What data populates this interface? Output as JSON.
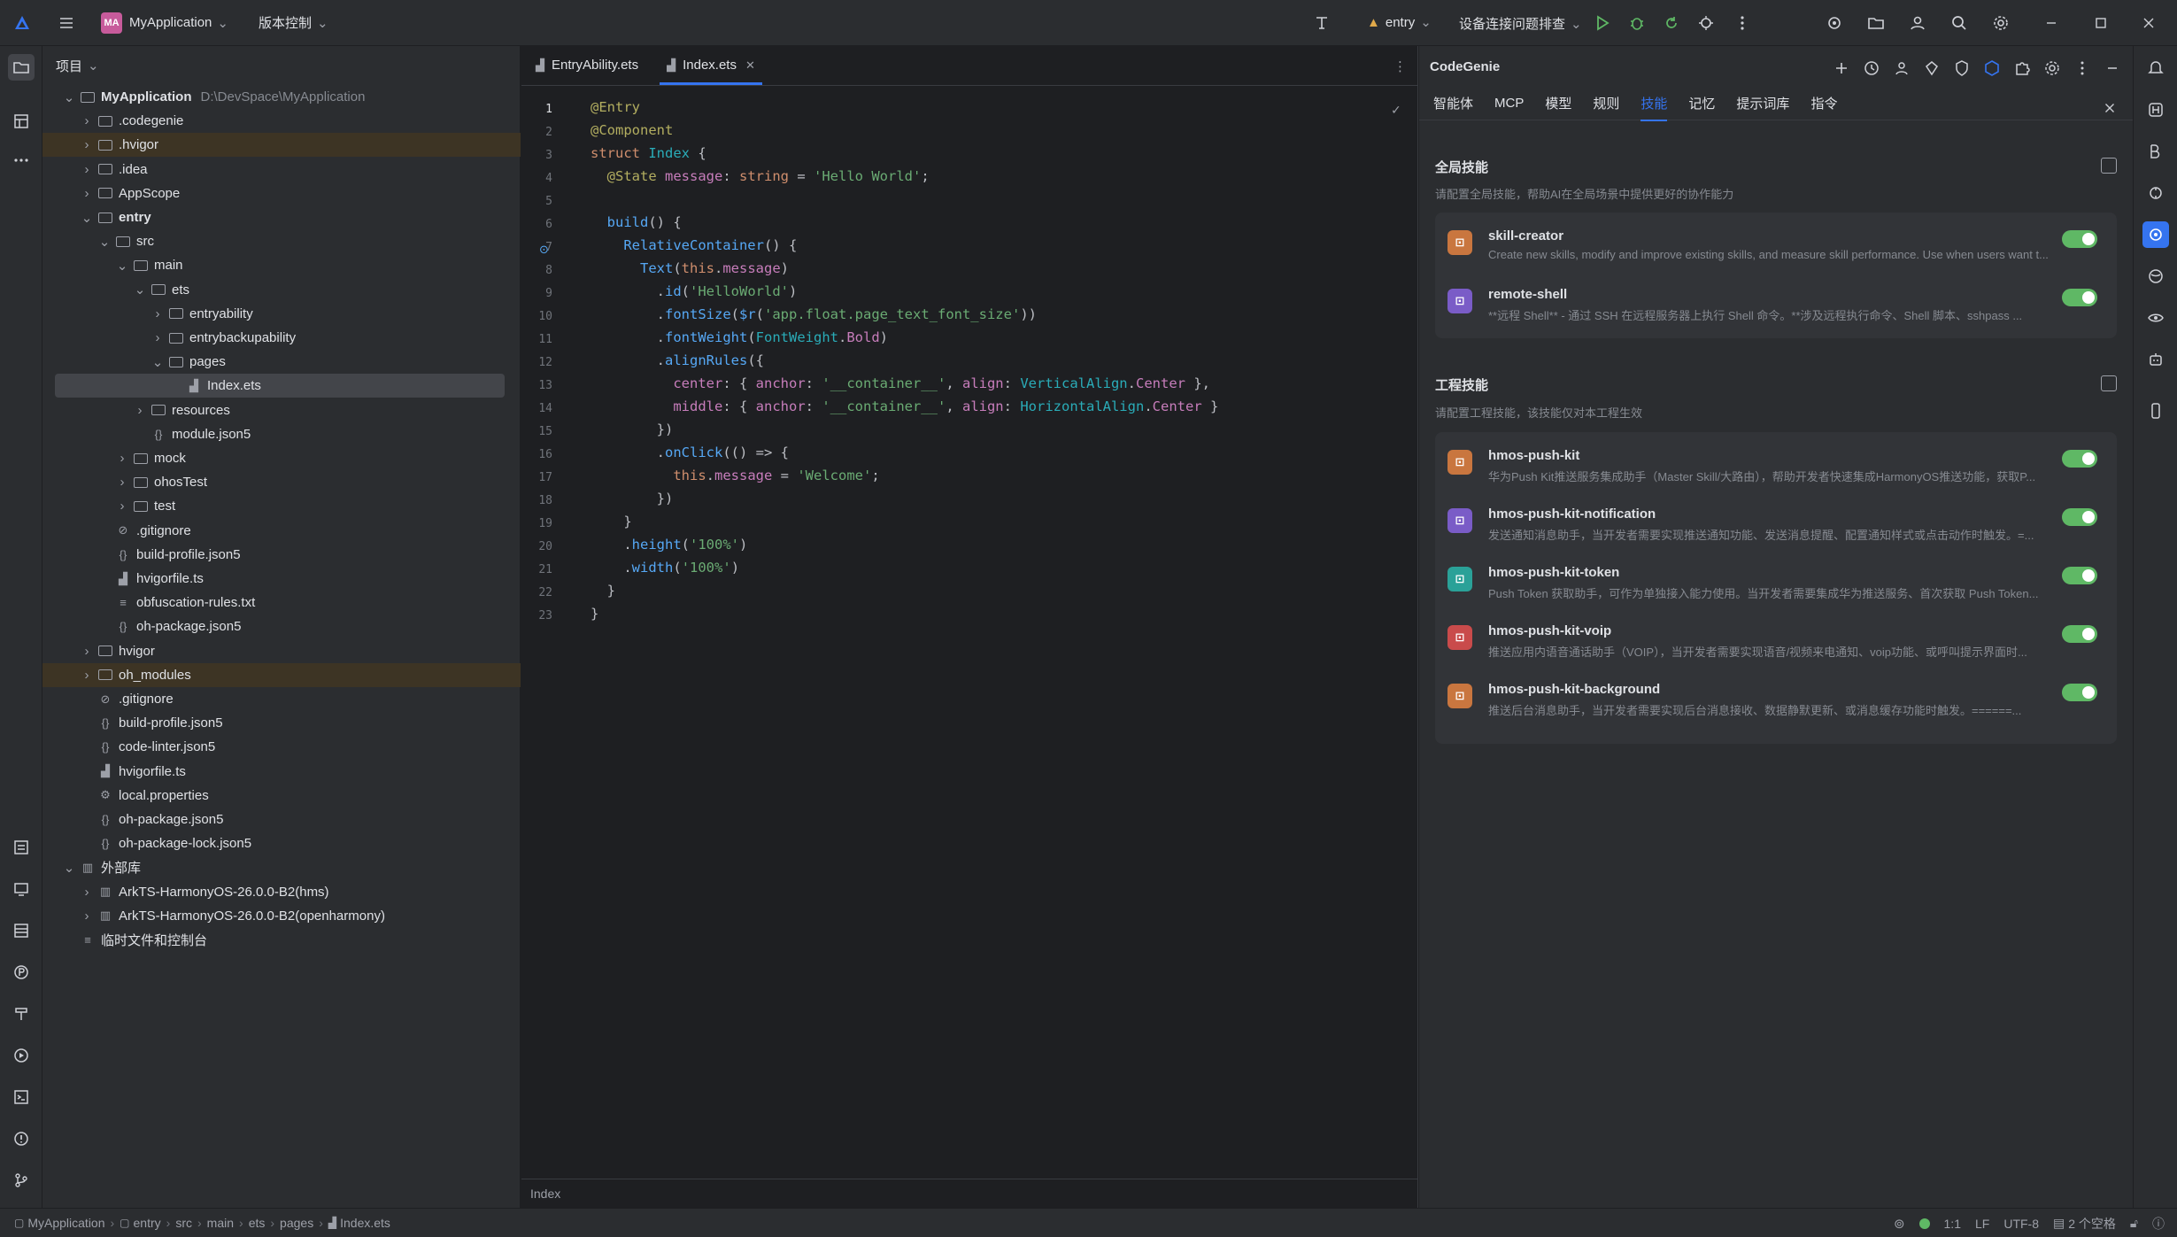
{
  "titlebar": {
    "project_badge": "MA",
    "project_name": "MyApplication",
    "vcs_label": "版本控制",
    "run_config": "entry",
    "device_label": "设备连接问题排查"
  },
  "project_panel": {
    "header": "项目",
    "root_name": "MyApplication",
    "root_path": "D:\\DevSpace\\MyApplication",
    "items": [
      ".codegenie",
      ".hvigor",
      ".idea",
      "AppScope",
      "entry",
      "src",
      "main",
      "ets",
      "entryability",
      "entrybackupability",
      "pages",
      "Index.ets",
      "resources",
      "module.json5",
      "mock",
      "ohosTest",
      "test",
      ".gitignore",
      "build-profile.json5",
      "hvigorfile.ts",
      "obfuscation-rules.txt",
      "oh-package.json5",
      "hvigor",
      "oh_modules",
      ".gitignore",
      "build-profile.json5",
      "code-linter.json5",
      "hvigorfile.ts",
      "local.properties",
      "oh-package.json5",
      "oh-package-lock.json5",
      "外部库",
      "ArkTS-HarmonyOS-26.0.0-B2(hms)",
      "ArkTS-HarmonyOS-26.0.0-B2(openharmony)",
      "临时文件和控制台"
    ]
  },
  "editor": {
    "tabs": [
      "EntryAbility.ets",
      "Index.ets"
    ],
    "footer": "Index",
    "line_numbers": [
      "1",
      "2",
      "3",
      "4",
      "5",
      "6",
      "7",
      "8",
      "9",
      "10",
      "11",
      "12",
      "13",
      "14",
      "15",
      "16",
      "17",
      "18",
      "19",
      "20",
      "21",
      "22",
      "23"
    ]
  },
  "codegenie": {
    "title": "CodeGenie",
    "tabs": [
      "智能体",
      "MCP",
      "模型",
      "规则",
      "技能",
      "记忆",
      "提示词库",
      "指令"
    ],
    "global_title": "全局技能",
    "global_sub": "请配置全局技能，帮助AI在全局场景中提供更好的协作能力",
    "project_title": "工程技能",
    "project_sub": "请配置工程技能，该技能仅对本工程生效",
    "global_skills": [
      {
        "name": "skill-creator",
        "desc": "Create new skills, modify and improve existing skills, and measure skill performance. Use when users want t..."
      },
      {
        "name": "remote-shell",
        "desc": "**远程 Shell** - 通过 SSH 在远程服务器上执行 Shell 命令。**涉及远程执行命令、Shell 脚本、sshpass ..."
      }
    ],
    "project_skills": [
      {
        "name": "hmos-push-kit",
        "desc": "华为Push Kit推送服务集成助手（Master Skill/大路由），帮助开发者快速集成HarmonyOS推送功能，获取P..."
      },
      {
        "name": "hmos-push-kit-notification",
        "desc": "发送通知消息助手，当开发者需要实现推送通知功能、发送消息提醒、配置通知样式或点击动作时触发。=..."
      },
      {
        "name": "hmos-push-kit-token",
        "desc": "Push Token 获取助手，可作为单独接入能力使用。当开发者需要集成华为推送服务、首次获取 Push Token..."
      },
      {
        "name": "hmos-push-kit-voip",
        "desc": "推送应用内语音通话助手（VOIP），当开发者需要实现语音/视频来电通知、voip功能、或呼叫提示界面时..."
      },
      {
        "name": "hmos-push-kit-background",
        "desc": "推送后台消息助手，当开发者需要实现后台消息接收、数据静默更新、或消息缓存功能时触发。======..."
      }
    ]
  },
  "statusbar": {
    "breadcrumbs": [
      "MyApplication",
      "entry",
      "src",
      "main",
      "ets",
      "pages",
      "Index.ets"
    ],
    "position": "1:1",
    "line_sep": "LF",
    "encoding": "UTF-8",
    "indent": "2 个空格"
  }
}
